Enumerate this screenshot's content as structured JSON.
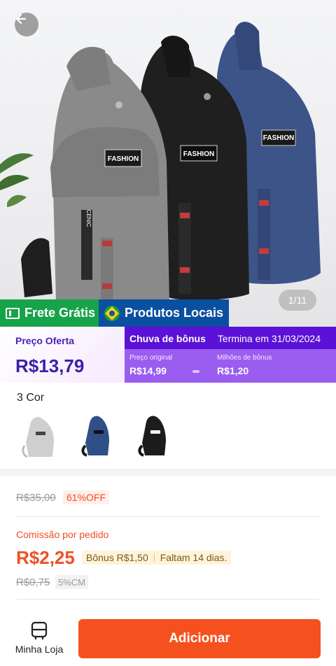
{
  "hero": {
    "image_counter": "1/11",
    "bag_label": "FASHION",
    "strap_text": "CENIC",
    "back_icon": "arrow-left-icon"
  },
  "badges": {
    "shipping": "Frete Grátis",
    "local": "Produtos Locais"
  },
  "price_banner": {
    "offer_label": "Preço Oferta",
    "offer_price": "R$13,79",
    "bonus_title": "Chuva de bônus",
    "bonus_ends": "Termina em 31/03/2024",
    "original_label": "Preço original",
    "original_value": "R$14,99",
    "miles_label": "Milhões de bônus",
    "miles_value": "R$1,20"
  },
  "colors": {
    "title": "3 Cor",
    "options": [
      {
        "name": "gray",
        "hex": "#bdbdbd"
      },
      {
        "name": "blue",
        "hex": "#2f4f86"
      },
      {
        "name": "black",
        "hex": "#1c1c1c"
      }
    ]
  },
  "pricing": {
    "old_price": "R$35,00",
    "discount": "61%OFF",
    "commission_label": "Comissão por pedido",
    "commission_value": "R$2,25",
    "bonus_chip": "Bônus R$1,50",
    "days_left": "Faltam 14 dias.",
    "old_commission": "R$0,75",
    "commission_percent": "5%CM"
  },
  "bottom_bar": {
    "store_label": "Minha Loja",
    "add_label": "Adicionar"
  },
  "theme": {
    "accent_orange": "#f5511e",
    "bonus_purple": "#5b12d6",
    "shipping_green": "#16a34a",
    "local_blue": "#0b4fa0"
  }
}
